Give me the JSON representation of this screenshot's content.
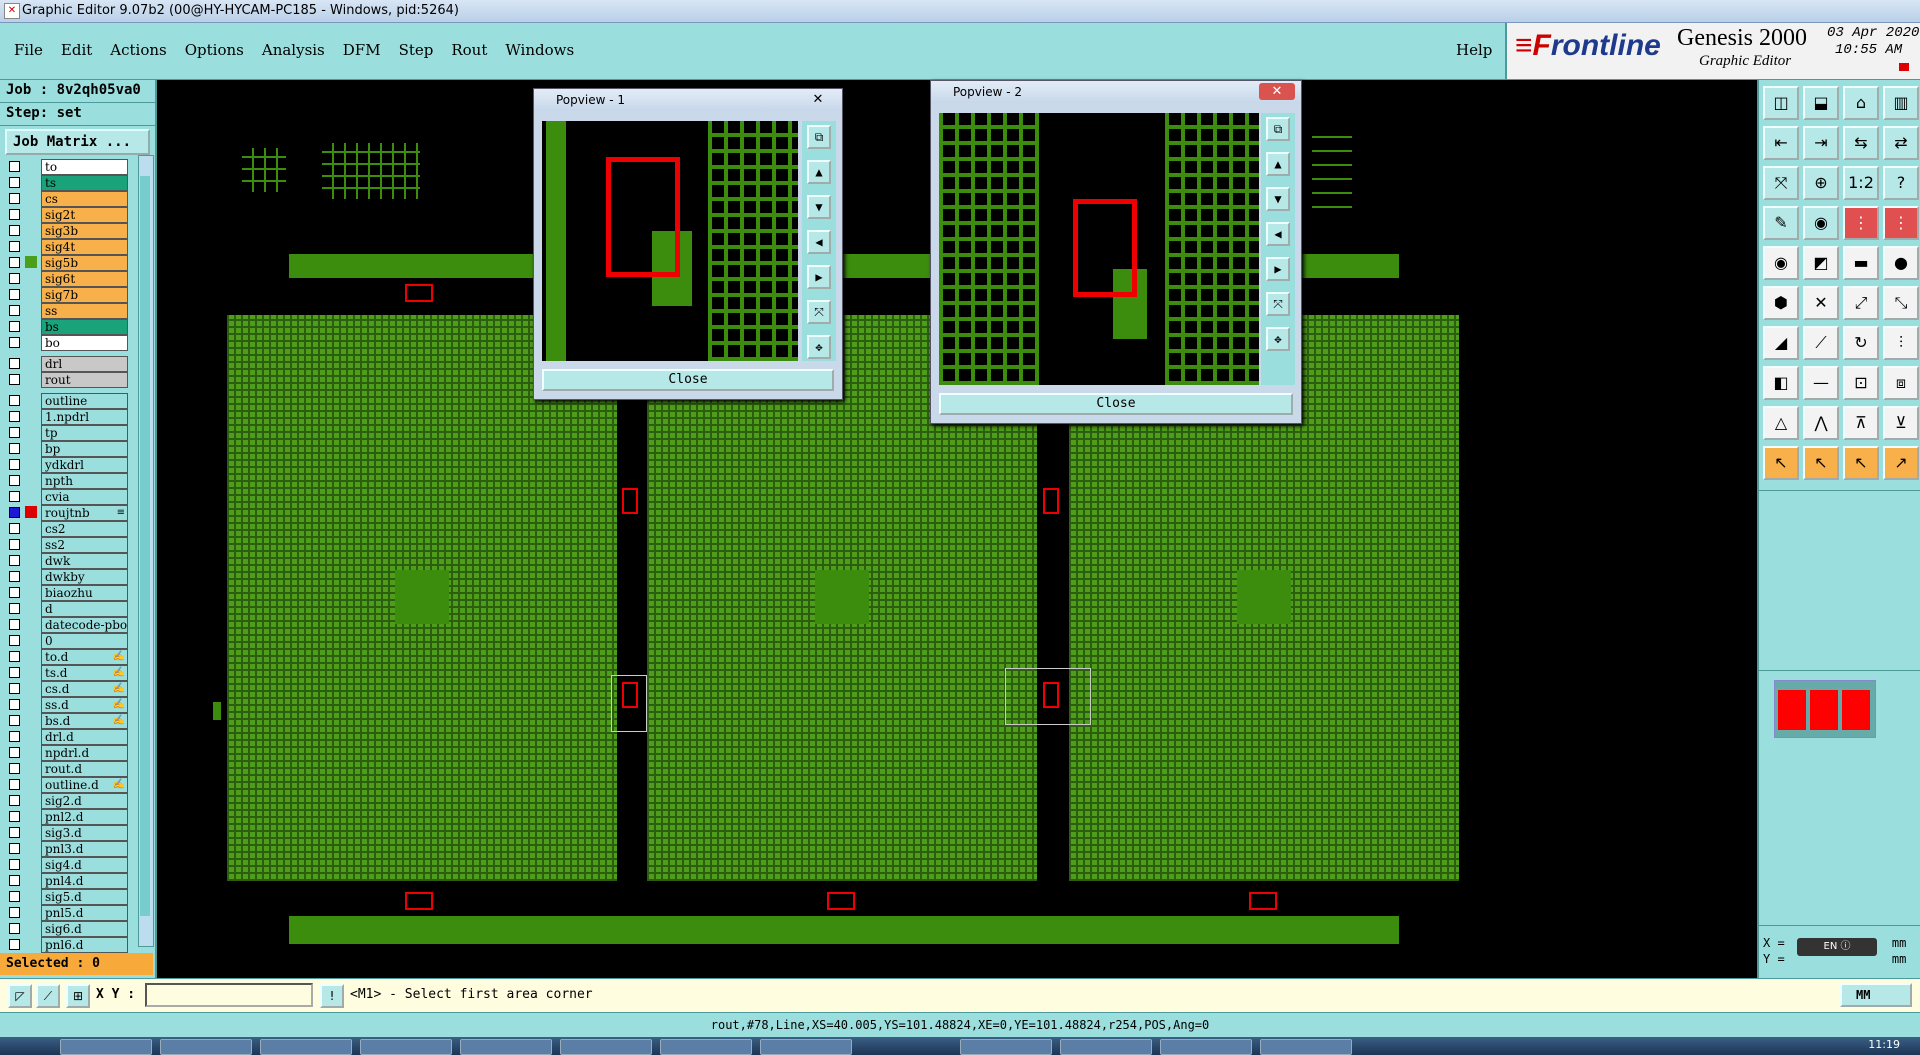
{
  "window": {
    "title": "Graphic Editor 9.07b2 (00@HY-HYCAM-PC185 - Windows, pid:5264)"
  },
  "menu": {
    "items": [
      "File",
      "Edit",
      "Actions",
      "Options",
      "Analysis",
      "DFM",
      "Step",
      "Rout",
      "Windows"
    ],
    "help": "Help"
  },
  "brand": {
    "logo": "Frontline",
    "product": "Genesis 2000",
    "subtitle": "Graphic Editor",
    "date": "03 Apr 2020",
    "time": "10:55 AM"
  },
  "left": {
    "job": "Job : 8v2qh05va0",
    "step": "Step: set",
    "job_matrix": "Job Matrix ...",
    "layers": [
      {
        "name": "to",
        "color": "#ffffff"
      },
      {
        "name": "ts",
        "color": "#1aa37a"
      },
      {
        "name": "cs",
        "color": "#f7b04a"
      },
      {
        "name": "sig2t",
        "color": "#f7b04a"
      },
      {
        "name": "sig3b",
        "color": "#f7b04a"
      },
      {
        "name": "sig4t",
        "color": "#f7b04a"
      },
      {
        "name": "sig5b",
        "color": "#f7b04a",
        "mark": "#4aa01a"
      },
      {
        "name": "sig6t",
        "color": "#f7b04a"
      },
      {
        "name": "sig7b",
        "color": "#f7b04a"
      },
      {
        "name": "ss",
        "color": "#f7b04a"
      },
      {
        "name": "bs",
        "color": "#1aa37a"
      },
      {
        "name": "bo",
        "color": "#ffffff"
      },
      {
        "name": "drl",
        "color": "#c8c8c8",
        "gap": true
      },
      {
        "name": "rout",
        "color": "#c8c8c8"
      },
      {
        "name": "outline",
        "color": "#9bdede",
        "gap": true
      },
      {
        "name": "1.npdrl",
        "color": "#9bdede"
      },
      {
        "name": "tp",
        "color": "#9bdede"
      },
      {
        "name": "bp",
        "color": "#9bdede"
      },
      {
        "name": "ydkdrl",
        "color": "#9bdede"
      },
      {
        "name": "npth",
        "color": "#9bdede"
      },
      {
        "name": "cvia",
        "color": "#9bdede"
      },
      {
        "name": "roujtnb",
        "color": "#9bdede",
        "on": true,
        "mark": "#dd0000",
        "sym": "≡"
      },
      {
        "name": "cs2",
        "color": "#9bdede"
      },
      {
        "name": "ss2",
        "color": "#9bdede"
      },
      {
        "name": "dwk",
        "color": "#9bdede"
      },
      {
        "name": "dwkby",
        "color": "#9bdede"
      },
      {
        "name": "biaozhu",
        "color": "#9bdede"
      },
      {
        "name": "d",
        "color": "#9bdede"
      },
      {
        "name": "datecode-pbo",
        "color": "#9bdede"
      },
      {
        "name": "0",
        "color": "#9bdede"
      },
      {
        "name": "to.d",
        "color": "#9bdede",
        "sym": "✍"
      },
      {
        "name": "ts.d",
        "color": "#9bdede",
        "sym": "✍"
      },
      {
        "name": "cs.d",
        "color": "#9bdede",
        "sym": "✍"
      },
      {
        "name": "ss.d",
        "color": "#9bdede",
        "sym": "✍"
      },
      {
        "name": "bs.d",
        "color": "#9bdede",
        "sym": "✍"
      },
      {
        "name": "drl.d",
        "color": "#9bdede"
      },
      {
        "name": "npdrl.d",
        "color": "#9bdede"
      },
      {
        "name": "rout.d",
        "color": "#9bdede"
      },
      {
        "name": "outline.d",
        "color": "#9bdede",
        "sym": "✍"
      },
      {
        "name": "sig2.d",
        "color": "#9bdede"
      },
      {
        "name": "pnl2.d",
        "color": "#9bdede"
      },
      {
        "name": "sig3.d",
        "color": "#9bdede"
      },
      {
        "name": "pnl3.d",
        "color": "#9bdede"
      },
      {
        "name": "sig4.d",
        "color": "#9bdede"
      },
      {
        "name": "pnl4.d",
        "color": "#9bdede"
      },
      {
        "name": "sig5.d",
        "color": "#9bdede"
      },
      {
        "name": "pnl5.d",
        "color": "#9bdede"
      },
      {
        "name": "sig6.d",
        "color": "#9bdede"
      },
      {
        "name": "pnl6.d",
        "color": "#9bdede"
      }
    ],
    "selected": "Selected : 0"
  },
  "popups": [
    {
      "title": "Popview - 1",
      "close": "Close"
    },
    {
      "title": "Popview - 2",
      "close": "Close"
    }
  ],
  "command": {
    "xy_label": "X Y :",
    "xy_value": "",
    "prompt": "<M1> - Select first area corner",
    "unit": "MM"
  },
  "coords": {
    "x_label": "X =",
    "y_label": "Y =",
    "x_unit": "mm",
    "y_unit": "mm",
    "lang": "EN"
  },
  "status": "rout,#78,Line,XS=40.005,YS=101.48824,XE=0,YE=101.48824,r254,POS,Ang=0",
  "taskbar": {
    "clock": "11:19"
  }
}
